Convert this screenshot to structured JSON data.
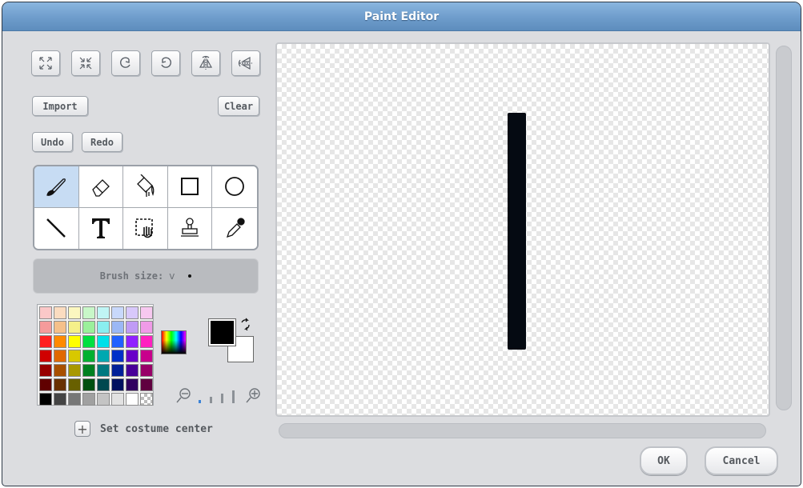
{
  "window": {
    "title": "Paint Editor"
  },
  "toolbar": {
    "transform_icons": [
      "grow-icon",
      "shrink-icon",
      "rotate-left-icon",
      "rotate-right-icon",
      "flip-horizontal-icon",
      "flip-vertical-icon"
    ],
    "import_label": "Import",
    "clear_label": "Clear",
    "undo_label": "Undo",
    "redo_label": "Redo"
  },
  "tools": [
    {
      "name": "paintbrush",
      "icon": "paintbrush-icon",
      "selected": true
    },
    {
      "name": "eraser",
      "icon": "eraser-icon",
      "selected": false
    },
    {
      "name": "fill",
      "icon": "paint-bucket-icon",
      "selected": false
    },
    {
      "name": "rectangle",
      "icon": "rectangle-icon",
      "selected": false
    },
    {
      "name": "ellipse",
      "icon": "ellipse-icon",
      "selected": false
    },
    {
      "name": "line",
      "icon": "line-icon",
      "selected": false
    },
    {
      "name": "text",
      "icon": "text-icon",
      "selected": false
    },
    {
      "name": "select",
      "icon": "select-icon",
      "selected": false
    },
    {
      "name": "stamp",
      "icon": "stamp-icon",
      "selected": false
    },
    {
      "name": "eyedropper",
      "icon": "eyedropper-icon",
      "selected": false
    }
  ],
  "brush": {
    "label": "Brush size:",
    "dropdown": "v"
  },
  "palette": {
    "rows": [
      [
        "#fbc8c8",
        "#fbdcc0",
        "#fbf7c0",
        "#c8f7c8",
        "#c0f5f5",
        "#c8d8fb",
        "#d8c8fb",
        "#f7c8f0"
      ],
      [
        "#f59b9b",
        "#f5c08a",
        "#f5f08a",
        "#9bf09b",
        "#8aeef0",
        "#9bb8f5",
        "#c09bf5",
        "#f09be8"
      ],
      [
        "#ff2020",
        "#ff8a00",
        "#ffff00",
        "#00e040",
        "#00e0e8",
        "#2060ff",
        "#9020ff",
        "#ff20c0"
      ],
      [
        "#d00000",
        "#e06800",
        "#d8c800",
        "#00b030",
        "#00a8b0",
        "#0030c8",
        "#6800c8",
        "#c8008c"
      ],
      [
        "#980000",
        "#a85000",
        "#a89800",
        "#008020",
        "#007880",
        "#002098",
        "#480098",
        "#980068"
      ],
      [
        "#600000",
        "#683000",
        "#686000",
        "#005010",
        "#004850",
        "#001060",
        "#300060",
        "#600040"
      ],
      [
        "#000000",
        "#444444",
        "#777777",
        "#a0a0a0",
        "#c4c4c4",
        "#e2e2e2",
        "#ffffff",
        "checker"
      ]
    ]
  },
  "colors": {
    "foreground": "#000000",
    "background": "#ffffff",
    "swap_icon": "swap-colors-icon",
    "picker_icon": "color-gradient-icon"
  },
  "zoom": {
    "out_icon": "zoom-out-icon",
    "in_icon": "zoom-in-icon",
    "level": 1,
    "levels": 4
  },
  "costume_center": {
    "label": "Set costume center",
    "icon": "plus-icon"
  },
  "canvas": {
    "stroke_color": "#050a12"
  },
  "dialog": {
    "ok_label": "OK",
    "cancel_label": "Cancel"
  }
}
